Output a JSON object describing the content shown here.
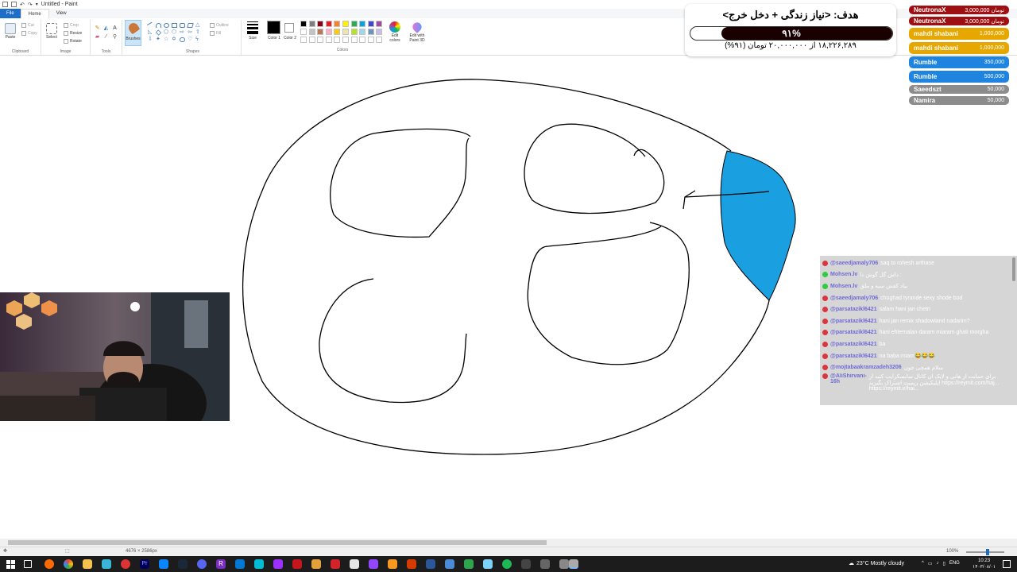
{
  "window": {
    "title": "Untitled - Paint"
  },
  "menu": {
    "file": "File",
    "home": "Home",
    "view": "View"
  },
  "ribbon": {
    "clipboard": {
      "paste": "Paste",
      "cut": "Cut",
      "copy": "Copy",
      "label": "Clipboard"
    },
    "image": {
      "select": "Select",
      "crop": "Crop",
      "resize": "Resize",
      "rotate": "Rotate",
      "label": "Image"
    },
    "tools": {
      "label": "Tools",
      "text_tool": "A"
    },
    "brushes": {
      "label": "Brushes"
    },
    "shapes": {
      "outline": "Outline",
      "fill": "Fill",
      "label": "Shapes"
    },
    "size": {
      "label": "Size"
    },
    "color1": {
      "label": "Color 1"
    },
    "color2": {
      "label": "Color 2"
    },
    "colors": {
      "label": "Colors"
    },
    "edit_colors": "Edit colors",
    "edit_paint3d": "Edit with Paint 3D",
    "swatches": [
      "#000000",
      "#7f7f7f",
      "#880015",
      "#ed1c24",
      "#ff7f27",
      "#fff200",
      "#22b14c",
      "#00a2e8",
      "#3f48cc",
      "#a349a4",
      "#ffffff",
      "#c3c3c3",
      "#b97a57",
      "#ffaec9",
      "#ffc90e",
      "#efe4b0",
      "#b5e61d",
      "#99d9ea",
      "#7092be",
      "#c8bfe7",
      "#ffffff",
      "#ffffff",
      "#ffffff",
      "#ffffff",
      "#ffffff",
      "#ffffff",
      "#ffffff",
      "#ffffff",
      "#ffffff",
      "#ffffff"
    ]
  },
  "goal": {
    "title": "هدف: <نیاز زندگی + دخل خرج>",
    "percent_label": "۹۱%",
    "progress": 0.91,
    "subtitle": "۱۸,۲۲۶,۲۸۹ از ۲۰,۰۰۰,۰۰۰ تومان (۹۱%)"
  },
  "donations": [
    {
      "name": "NeutronaX",
      "amount": "3,000,000 تومان",
      "color": "#9e0f12"
    },
    {
      "name": "NeutronaX",
      "amount": "3,000,000 تومان",
      "color": "#9e0f12"
    },
    {
      "name": "mahdi shabani",
      "amount": "1,000,000",
      "color": "#e6a800"
    },
    {
      "name": "mahdi shabani",
      "amount": "1,000,000",
      "color": "#e6a800"
    },
    {
      "name": "Rumble",
      "amount": "350,000",
      "color": "#1f84e0"
    },
    {
      "name": "Rumble",
      "amount": "500,000",
      "color": "#1f84e0"
    },
    {
      "name": "Saeedszt",
      "amount": "50,000",
      "color": "#8c8c8c"
    },
    {
      "name": "Namira",
      "amount": "50,000",
      "color": "#8c8c8c"
    }
  ],
  "chat": [
    {
      "user": "@saeedjamaly706",
      "text": "saq to rohesh arthase",
      "badge": "#d9363e"
    },
    {
      "user": "Mohsen.lv",
      "text": "داش گل گوش دا :",
      "badge": "#2ecc40"
    },
    {
      "user": "Mohsen.lv",
      "text": "بیاد کفش سیه و ملق",
      "badge": "#2ecc40"
    },
    {
      "user": "@saeedjamaly706",
      "text": "choghad tyrande sexy shode bod",
      "badge": "#d9363e"
    },
    {
      "user": "@parsatazikl6421",
      "text": "salam hani jan chetri",
      "badge": "#d9363e"
    },
    {
      "user": "@parsatazikl6421",
      "text": "hani jan remix shadowland nadarim?",
      "badge": "#d9363e"
    },
    {
      "user": "@parsatazikl6421",
      "text": "hani ehtemalan daram miaram ghati morgha",
      "badge": "#d9363e"
    },
    {
      "user": "@parsatazikl6421",
      "text": "ba",
      "badge": "#d9363e"
    },
    {
      "user": "@parsatazikl6421",
      "text": "na baba miam😂😂😂",
      "badge": "#d9363e"
    },
    {
      "user": "@mojtabaakramzadeh3206",
      "text": "سلام همچی جون",
      "badge": "#d9363e"
    },
    {
      "user": "@AliShirvani-16h",
      "text": "برای حمایت از هانی و لایک ان کانال سابسکرایب کنید از اپلیکیشن ریمیت اشتراک بگیرید https://reymit.com/haj... https://reymit.ir/hai...",
      "badge": "#d9363e"
    }
  ],
  "statusbar": {
    "dimensions": "4676 × 2586px",
    "zoom": "100%"
  },
  "taskbar": {
    "weather": "23°C  Mostly cloudy",
    "lang": "ENG",
    "time": "10:23",
    "date": "۱۴۰۳/۰۸/۰۱"
  }
}
